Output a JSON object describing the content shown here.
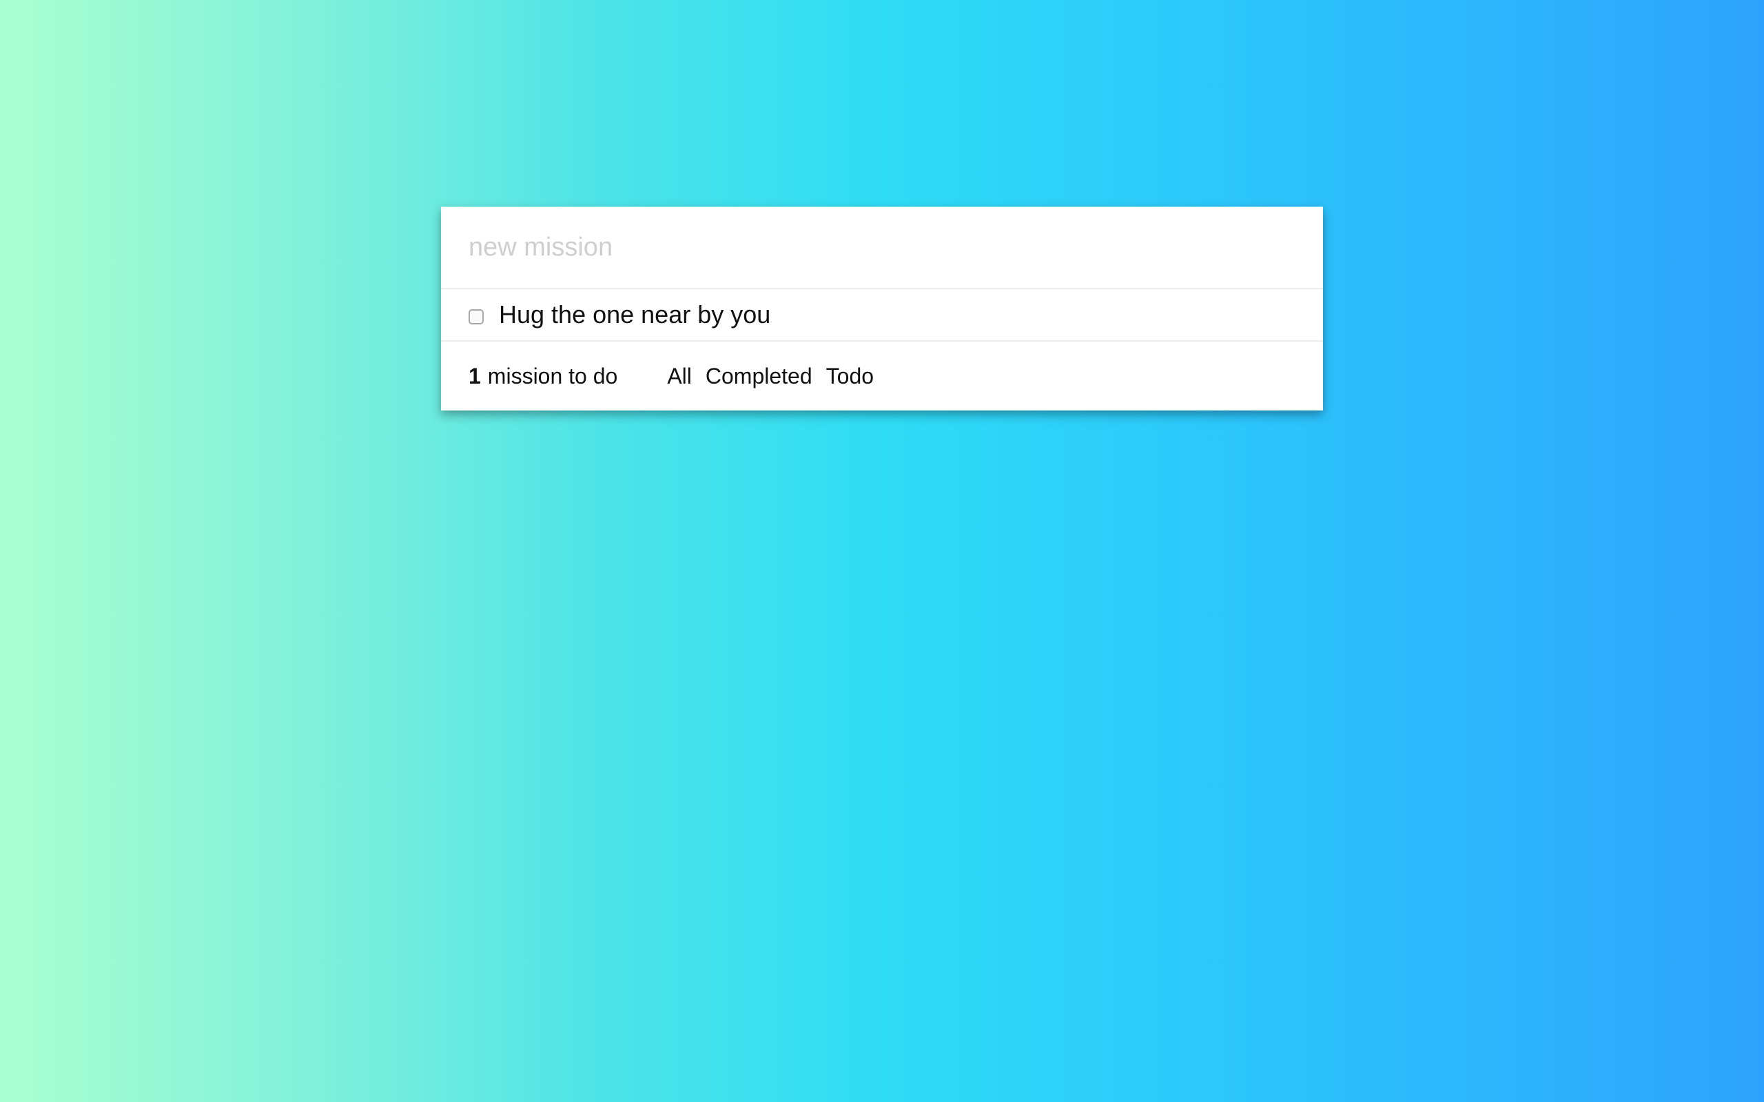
{
  "new_mission": {
    "placeholder": "new mission",
    "value": ""
  },
  "todos": [
    {
      "text": "Hug the one near by you",
      "checked": false
    }
  ],
  "footer": {
    "count": "1",
    "count_label": "mission to do",
    "filters": [
      "All",
      "Completed",
      "Todo"
    ]
  },
  "colors": {
    "gradient_left": "#aaffd1",
    "gradient_mid": "#2fdcf5",
    "gradient_right": "#2ea3fd",
    "panel": "#ffffff"
  }
}
